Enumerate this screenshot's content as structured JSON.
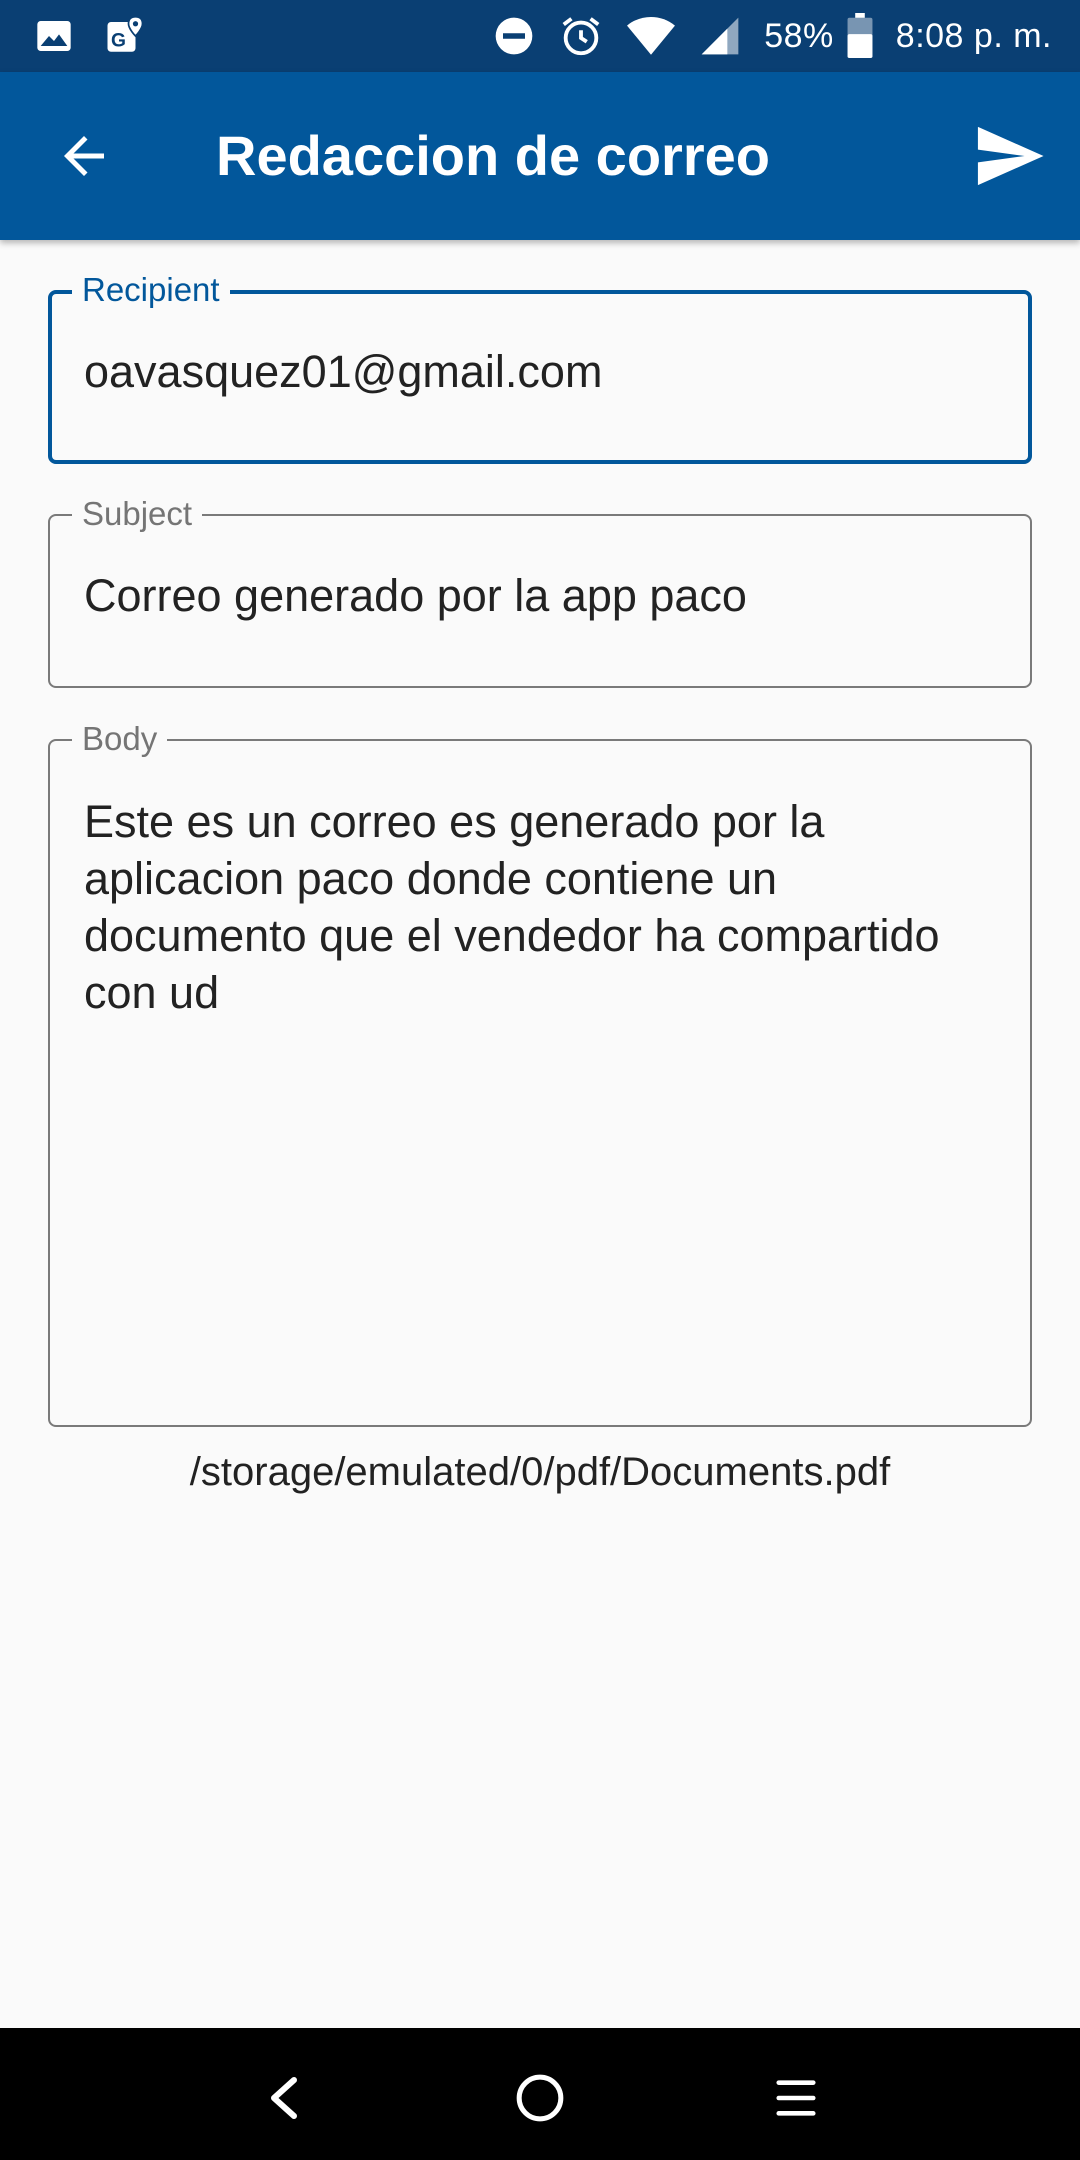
{
  "status_bar": {
    "battery": "58%",
    "time": "8:08 p. m.",
    "icons": [
      "image-icon",
      "maps-icon",
      "do-not-disturb-icon",
      "alarm-icon",
      "wifi-icon",
      "signal-icon",
      "battery-icon"
    ]
  },
  "app_bar": {
    "title": "Redaccion de correo",
    "back_icon": "arrow-back-icon",
    "send_icon": "send-icon"
  },
  "form": {
    "recipient": {
      "label": "Recipient",
      "value": "oavasquez01@gmail.com"
    },
    "subject": {
      "label": "Subject",
      "value": "Correo generado por la app paco"
    },
    "body": {
      "label": "Body",
      "value": "Este es un correo es generado por la aplicacion paco donde contiene un documento que el vendedor ha compartido con ud"
    }
  },
  "attachment_path": "/storage/emulated/0/pdf/Documents.pdf",
  "nav_bar": {
    "icons": [
      "nav-back-icon",
      "nav-home-icon",
      "nav-menu-icon"
    ]
  },
  "colors": {
    "status_bar": "#0a3f73",
    "app_bar": "#02579b",
    "accent": "#02579b",
    "background": "#fafafa",
    "nav_bar": "#000000"
  }
}
